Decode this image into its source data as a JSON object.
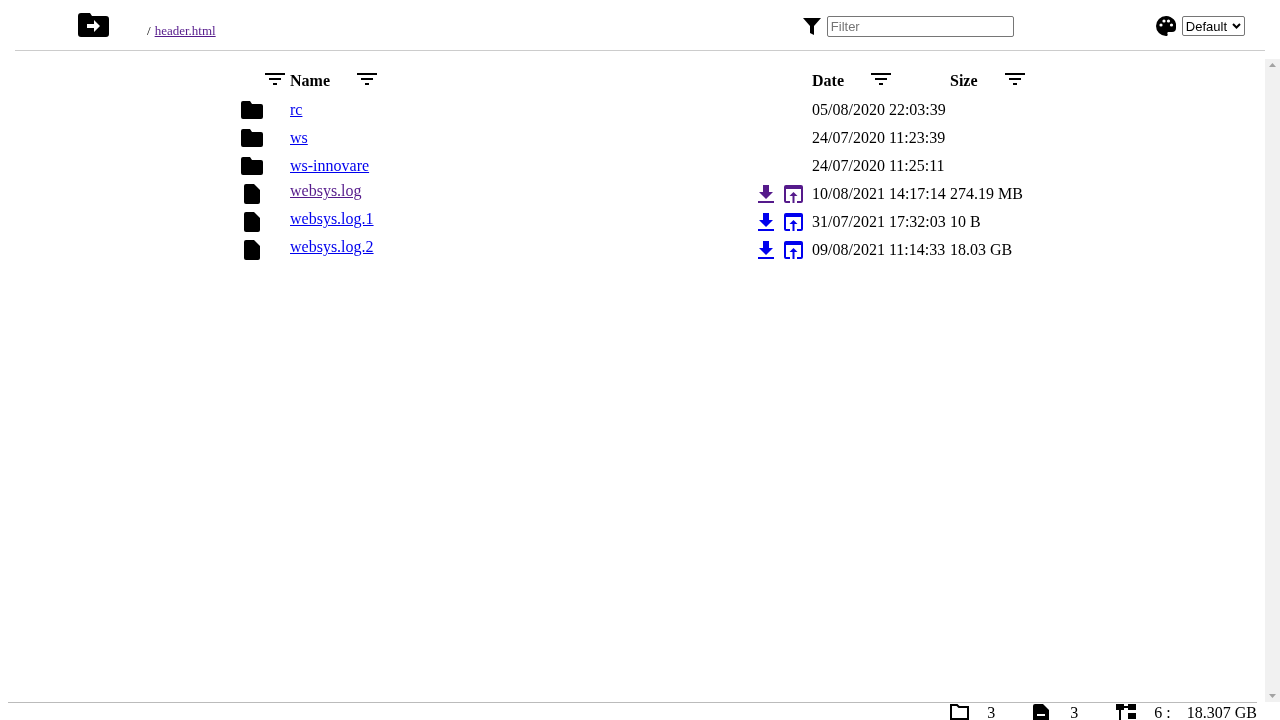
{
  "breadcrumb": {
    "separator": "/",
    "link": {
      "label": "header.html",
      "visited": true
    }
  },
  "filter": {
    "placeholder": "Filter"
  },
  "theme": {
    "value": "Default"
  },
  "columns": [
    {
      "label": "Name"
    },
    {
      "label": "Date"
    },
    {
      "label": "Size"
    }
  ],
  "rows": [
    {
      "kind": "folder",
      "name": "rc",
      "visited": false,
      "date": "05/08/2020 22:03:39"
    },
    {
      "kind": "folder",
      "name": "ws",
      "visited": false,
      "date": "24/07/2020 11:23:39"
    },
    {
      "kind": "folder",
      "name": "ws-innovare",
      "visited": false,
      "date": "24/07/2020 11:25:11"
    },
    {
      "kind": "file",
      "name": "websys.log",
      "visited": true,
      "date": "10/08/2021 14:17:14",
      "size": "274.19 MB"
    },
    {
      "kind": "file",
      "name": "websys.log.1",
      "visited": false,
      "date": "31/07/2021 17:32:03",
      "size": "10 B"
    },
    {
      "kind": "file",
      "name": "websys.log.2",
      "visited": false,
      "date": "09/08/2021 11:14:33",
      "size": "18.03 GB"
    }
  ],
  "footer": {
    "folders": "3",
    "files": "3",
    "total_count": "6 :",
    "total_size": "18.307 GB"
  }
}
